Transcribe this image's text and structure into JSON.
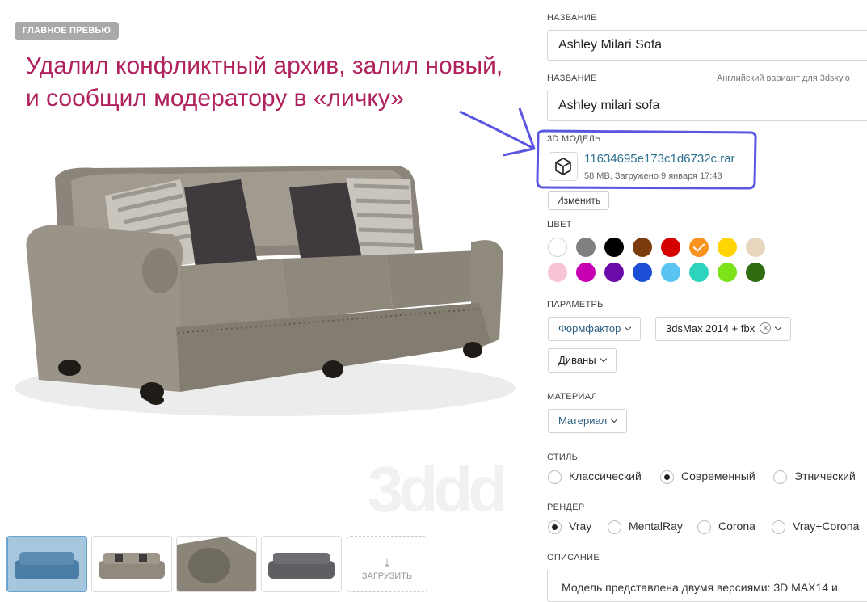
{
  "preview": {
    "badge": "ГЛАВНОЕ ПРЕВЬЮ",
    "annotation_line1": "Удалил конфликтный архив, залил новый,",
    "annotation_line2": "и сообщил модератору в «личку»",
    "watermark": "3ddd",
    "upload_label": "ЗАГРУЗИТЬ"
  },
  "form": {
    "name_label": "НАЗВАНИЕ",
    "name_value": "Ashley Milari Sofa",
    "name_en_label": "НАЗВАНИЕ",
    "name_en_hint": "Английский вариант для 3dsky.o",
    "name_en_value": "Ashley milari sofa",
    "model_label": "3D МОДЕЛЬ",
    "file_name": "11634695e173c1d6732c.rar",
    "file_meta": "58 MB, Загружено 9 января 17:43",
    "change_button": "Изменить",
    "color_label": "ЦВЕТ",
    "colors": [
      "#ffffff",
      "#808080",
      "#000000",
      "#7a3b0d",
      "#d40000",
      "#f7931e",
      "#ffd400",
      "#e8d7be",
      "#f9c3d6",
      "#c800b4",
      "#6a0aa8",
      "#1a4fd6",
      "#5bc3f0",
      "#2ed3be",
      "#7ce21a",
      "#2f6b0f"
    ],
    "selected_color_index": 5,
    "params_label": "ПАРАМЕТРЫ",
    "formfactor_btn": "Формфактор",
    "software_btn": "3dsMax 2014 + fbx",
    "category_btn": "Диваны",
    "material_label": "МАТЕРИАЛ",
    "material_btn": "Материал",
    "style_label": "СТИЛЬ",
    "style_options": [
      "Классический",
      "Современный",
      "Этнический"
    ],
    "style_selected": 1,
    "render_label": "РЕНДЕР",
    "render_options": [
      "Vray",
      "MentalRay",
      "Corona",
      "Vray+Corona"
    ],
    "render_selected": 0,
    "description_label": "ОПИСАНИЕ",
    "description_text": "Модель представлена двумя версиями: 3D MAX14 и"
  }
}
